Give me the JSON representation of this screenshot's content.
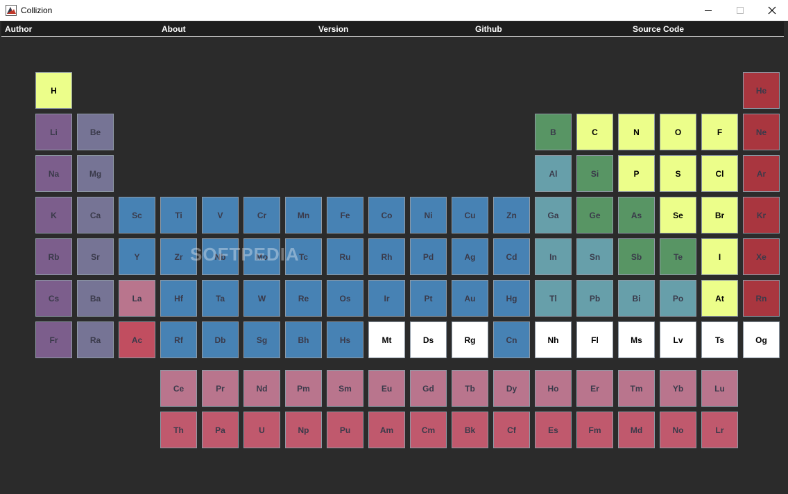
{
  "window": {
    "title": "Collizion"
  },
  "menu": [
    "Author",
    "About",
    "Version",
    "Github",
    "Source Code"
  ],
  "watermark": "SOFTPEDIA",
  "colors": {
    "A": "#7c5e8c",
    "B": "#767495",
    "C": "#4782b4",
    "D": "#b9758d",
    "E": "#c14e60",
    "F": "#589564",
    "G": "#679faa",
    "H": "#ecfe8a",
    "I": "#a9363f",
    "J": "#ffffff",
    "K": "#c0596d"
  },
  "textColors": {
    "dark": "#3a3a4a",
    "black": "#000000"
  },
  "elements": [
    {
      "s": "H",
      "c": "H"
    },
    {
      "s": "He",
      "c": "I"
    },
    {
      "s": "Li",
      "c": "A"
    },
    {
      "s": "Be",
      "c": "B"
    },
    {
      "s": "B",
      "c": "F"
    },
    {
      "s": "C",
      "c": "H"
    },
    {
      "s": "N",
      "c": "H"
    },
    {
      "s": "O",
      "c": "H"
    },
    {
      "s": "F",
      "c": "H"
    },
    {
      "s": "Ne",
      "c": "I"
    },
    {
      "s": "Na",
      "c": "A"
    },
    {
      "s": "Mg",
      "c": "B"
    },
    {
      "s": "Al",
      "c": "G"
    },
    {
      "s": "Si",
      "c": "F"
    },
    {
      "s": "P",
      "c": "H"
    },
    {
      "s": "S",
      "c": "H"
    },
    {
      "s": "Cl",
      "c": "H"
    },
    {
      "s": "Ar",
      "c": "I"
    },
    {
      "s": "K",
      "c": "A"
    },
    {
      "s": "Ca",
      "c": "B"
    },
    {
      "s": "Sc",
      "c": "C"
    },
    {
      "s": "Ti",
      "c": "C"
    },
    {
      "s": "V",
      "c": "C"
    },
    {
      "s": "Cr",
      "c": "C"
    },
    {
      "s": "Mn",
      "c": "C"
    },
    {
      "s": "Fe",
      "c": "C"
    },
    {
      "s": "Co",
      "c": "C"
    },
    {
      "s": "Ni",
      "c": "C"
    },
    {
      "s": "Cu",
      "c": "C"
    },
    {
      "s": "Zn",
      "c": "C"
    },
    {
      "s": "Ga",
      "c": "G"
    },
    {
      "s": "Ge",
      "c": "F"
    },
    {
      "s": "As",
      "c": "F"
    },
    {
      "s": "Se",
      "c": "H"
    },
    {
      "s": "Br",
      "c": "H"
    },
    {
      "s": "Kr",
      "c": "I"
    },
    {
      "s": "Rb",
      "c": "A"
    },
    {
      "s": "Sr",
      "c": "B"
    },
    {
      "s": "Y",
      "c": "C"
    },
    {
      "s": "Zr",
      "c": "C"
    },
    {
      "s": "Nb",
      "c": "C"
    },
    {
      "s": "Mo",
      "c": "C"
    },
    {
      "s": "Tc",
      "c": "C"
    },
    {
      "s": "Ru",
      "c": "C"
    },
    {
      "s": "Rh",
      "c": "C"
    },
    {
      "s": "Pd",
      "c": "C"
    },
    {
      "s": "Ag",
      "c": "C"
    },
    {
      "s": "Cd",
      "c": "C"
    },
    {
      "s": "In",
      "c": "G"
    },
    {
      "s": "Sn",
      "c": "G"
    },
    {
      "s": "Sb",
      "c": "F"
    },
    {
      "s": "Te",
      "c": "F"
    },
    {
      "s": "I",
      "c": "H"
    },
    {
      "s": "Xe",
      "c": "I"
    },
    {
      "s": "Cs",
      "c": "A"
    },
    {
      "s": "Ba",
      "c": "B"
    },
    {
      "s": "La",
      "c": "D"
    },
    {
      "s": "Hf",
      "c": "C"
    },
    {
      "s": "Ta",
      "c": "C"
    },
    {
      "s": "W",
      "c": "C"
    },
    {
      "s": "Re",
      "c": "C"
    },
    {
      "s": "Os",
      "c": "C"
    },
    {
      "s": "Ir",
      "c": "C"
    },
    {
      "s": "Pt",
      "c": "C"
    },
    {
      "s": "Au",
      "c": "C"
    },
    {
      "s": "Hg",
      "c": "C"
    },
    {
      "s": "Tl",
      "c": "G"
    },
    {
      "s": "Pb",
      "c": "G"
    },
    {
      "s": "Bi",
      "c": "G"
    },
    {
      "s": "Po",
      "c": "G"
    },
    {
      "s": "At",
      "c": "H"
    },
    {
      "s": "Rn",
      "c": "I"
    },
    {
      "s": "Fr",
      "c": "A"
    },
    {
      "s": "Ra",
      "c": "B"
    },
    {
      "s": "Ac",
      "c": "E"
    },
    {
      "s": "Rf",
      "c": "C"
    },
    {
      "s": "Db",
      "c": "C"
    },
    {
      "s": "Sg",
      "c": "C"
    },
    {
      "s": "Bh",
      "c": "C"
    },
    {
      "s": "Hs",
      "c": "C"
    },
    {
      "s": "Mt",
      "c": "J"
    },
    {
      "s": "Ds",
      "c": "J"
    },
    {
      "s": "Rg",
      "c": "J"
    },
    {
      "s": "Cn",
      "c": "C"
    },
    {
      "s": "Nh",
      "c": "J"
    },
    {
      "s": "Fl",
      "c": "J"
    },
    {
      "s": "Ms",
      "c": "J"
    },
    {
      "s": "Lv",
      "c": "J"
    },
    {
      "s": "Ts",
      "c": "J"
    },
    {
      "s": "Og",
      "c": "J"
    },
    {
      "s": "Ce",
      "c": "D"
    },
    {
      "s": "Pr",
      "c": "D"
    },
    {
      "s": "Nd",
      "c": "D"
    },
    {
      "s": "Pm",
      "c": "D"
    },
    {
      "s": "Sm",
      "c": "D"
    },
    {
      "s": "Eu",
      "c": "D"
    },
    {
      "s": "Gd",
      "c": "D"
    },
    {
      "s": "Tb",
      "c": "D"
    },
    {
      "s": "Dy",
      "c": "D"
    },
    {
      "s": "Ho",
      "c": "D"
    },
    {
      "s": "Er",
      "c": "D"
    },
    {
      "s": "Tm",
      "c": "D"
    },
    {
      "s": "Yb",
      "c": "D"
    },
    {
      "s": "Lu",
      "c": "D"
    },
    {
      "s": "Th",
      "c": "K"
    },
    {
      "s": "Pa",
      "c": "K"
    },
    {
      "s": "U",
      "c": "K"
    },
    {
      "s": "Np",
      "c": "K"
    },
    {
      "s": "Pu",
      "c": "K"
    },
    {
      "s": "Am",
      "c": "K"
    },
    {
      "s": "Cm",
      "c": "K"
    },
    {
      "s": "Bk",
      "c": "K"
    },
    {
      "s": "Cf",
      "c": "K"
    },
    {
      "s": "Es",
      "c": "K"
    },
    {
      "s": "Fm",
      "c": "K"
    },
    {
      "s": "Md",
      "c": "K"
    },
    {
      "s": "No",
      "c": "K"
    },
    {
      "s": "Lr",
      "c": "K"
    }
  ]
}
